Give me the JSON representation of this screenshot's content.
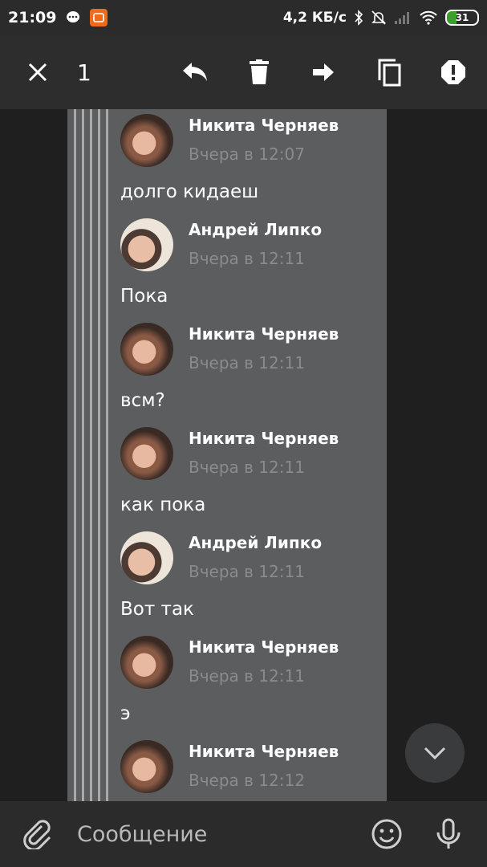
{
  "status_bar": {
    "time": "21:09",
    "speed": "4,2 КБ/с",
    "battery": "31"
  },
  "action_bar": {
    "selected_count": "1",
    "icons": [
      "close-icon",
      "reply-icon",
      "delete-icon",
      "forward-icon",
      "copy-icon",
      "report-icon"
    ]
  },
  "messages": [
    {
      "author": "Никита Черняев",
      "time": "Вчера в 12:07",
      "text": "долго кидаеш"
    },
    {
      "author": "Андрей Липко",
      "time": "Вчера в 12:11",
      "text": "Пока"
    },
    {
      "author": "Никита Черняев",
      "time": "Вчера в 12:11",
      "text": "всм?"
    },
    {
      "author": "Никита Черняев",
      "time": "Вчера в 12:11",
      "text": "как пока"
    },
    {
      "author": "Андрей Липко",
      "time": "Вчера в 12:11",
      "text": "Вот так"
    },
    {
      "author": "Никита Черняев",
      "time": "Вчера в 12:11",
      "text": "э"
    },
    {
      "author": "Никита Черняев",
      "time": "Вчера в 12:12",
      "text": ""
    }
  ],
  "composer": {
    "placeholder": "Сообщение"
  },
  "colors": {
    "card_bg": "#5c5d5f",
    "bar_bg": "#2d2d2d",
    "accent_orange": "#f06a1d"
  }
}
